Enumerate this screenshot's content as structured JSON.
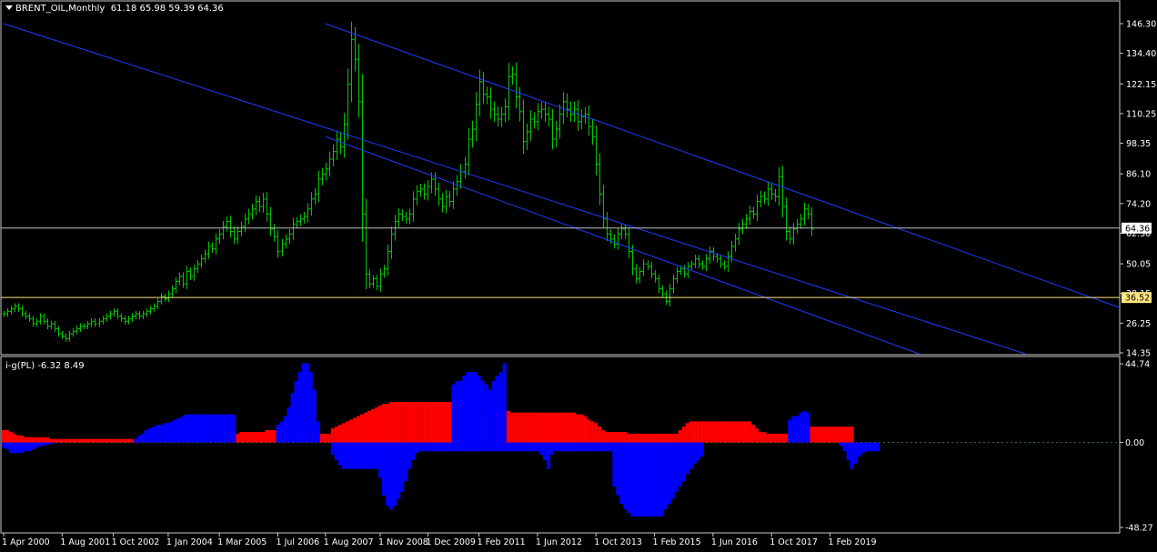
{
  "header": {
    "symbol_label": "BRENT_OIL,Monthly",
    "ohlc": "61.18 65.98 59.39 64.36",
    "dropdown_icon": "triangle-down-icon"
  },
  "indicator": {
    "label": "i-g(PL)",
    "values": "-6.32 8.49"
  },
  "chart_data": [
    {
      "type": "line",
      "subtype": "ohlc-bars",
      "title": "BRENT_OIL,Monthly",
      "ylim": [
        14.35,
        146.3
      ],
      "y_ticks": [
        "146.30",
        "134.40",
        "122.15",
        "110.25",
        "98.35",
        "86.10",
        "74.20",
        "62.30",
        "50.05",
        "38.15",
        "26.25",
        "14.35"
      ],
      "x_ticks": [
        "1 Apr 2000",
        "1 Aug 2001",
        "1 Oct 2002",
        "1 Jan 2004",
        "1 Mar 2005",
        "1 Jul 2006",
        "1 Aug 2007",
        "1 Nov 2008",
        "1 Dec 2009",
        "1 Feb 2011",
        "1 Jun 2012",
        "1 Oct 2013",
        "1 Feb 2015",
        "1 Jun 2016",
        "1 Oct 2017",
        "1 Feb 2019"
      ],
      "x_tick_index": [
        0,
        16,
        30,
        45,
        59,
        75,
        88,
        103,
        116,
        130,
        146,
        162,
        178,
        194,
        210,
        226
      ],
      "current_price": "64.36",
      "level_line": "36.52",
      "closes": [
        30,
        31,
        32,
        33,
        32,
        30,
        29,
        28,
        26,
        27,
        29,
        27,
        25,
        26,
        24,
        22,
        21,
        20,
        22,
        23,
        24,
        25,
        25,
        26,
        27,
        26,
        27,
        28,
        29,
        30,
        31,
        29,
        28,
        27,
        28,
        29,
        30,
        29,
        30,
        31,
        32,
        33,
        35,
        37,
        36,
        38,
        40,
        43,
        45,
        42,
        47,
        45,
        48,
        50,
        52,
        54,
        57,
        56,
        60,
        62,
        65,
        67,
        63,
        60,
        63,
        65,
        68,
        70,
        72,
        75,
        73,
        76,
        70,
        64,
        61,
        55,
        58,
        60,
        62,
        66,
        67,
        68,
        69,
        72,
        76,
        78,
        84,
        86,
        88,
        92,
        95,
        100,
        97,
        106,
        122,
        140,
        132,
        115,
        70,
        46,
        42,
        44,
        41,
        46,
        48,
        55,
        62,
        67,
        70,
        69,
        68,
        70,
        76,
        79,
        80,
        78,
        81,
        84,
        80,
        76,
        73,
        77,
        75,
        80,
        83,
        87,
        90,
        100,
        104,
        114,
        123,
        118,
        117,
        112,
        110,
        108,
        110,
        113,
        125,
        126,
        117,
        111,
        99,
        103,
        108,
        107,
        111,
        112,
        110,
        108,
        100,
        104,
        110,
        115,
        112,
        110,
        112,
        107,
        109,
        110,
        105,
        101,
        90,
        78,
        68,
        62,
        60,
        58,
        62,
        64,
        62,
        55,
        48,
        44,
        47,
        50,
        49,
        46,
        44,
        40,
        38,
        35,
        40,
        44,
        47,
        48,
        46,
        49,
        50,
        52,
        50,
        49,
        52,
        55,
        53,
        52,
        50,
        49,
        53,
        57,
        60,
        64,
        66,
        68,
        71,
        70,
        75,
        77,
        76,
        80,
        78,
        77,
        85,
        73,
        63,
        60,
        64,
        66,
        68,
        72,
        70,
        64
      ],
      "trendlines": [
        {
          "from": [
            "1 Apr 2000",
            146.3
          ],
          "to": [
            "1 Feb 2015",
            62.0
          ]
        },
        {
          "from": [
            "1 Aug 2007",
            146.3
          ],
          "to": [
            "1 Feb 2019",
            74.0
          ]
        },
        {
          "from": [
            "1 Aug 2007",
            101.0
          ],
          "to": [
            "1 Feb 2019",
            27.0
          ]
        }
      ]
    },
    {
      "type": "bar",
      "title": "i-g(PL) -6.32 8.49",
      "ylim": [
        -48.27,
        44.74
      ],
      "y_ticks": [
        "44.74",
        "0.00",
        "-48.27"
      ],
      "zero_label": "0.00",
      "series": [
        {
          "color": "#ff0000",
          "values": [
            7,
            7,
            6,
            5,
            4,
            4,
            3,
            3,
            3,
            3,
            3,
            3,
            3,
            2,
            2,
            2,
            2,
            2,
            2,
            2,
            2,
            2,
            2,
            2,
            2,
            2,
            2,
            2,
            2,
            2,
            2,
            2,
            2,
            2,
            2,
            2,
            2,
            2,
            2,
            2,
            2,
            2,
            2,
            2,
            2,
            2,
            2,
            2,
            3,
            3,
            4,
            4,
            4,
            4,
            4,
            4,
            4,
            4,
            4,
            4,
            5,
            5,
            5,
            5,
            5,
            6,
            6,
            6,
            6,
            6,
            6,
            6,
            7,
            7,
            7,
            7,
            7,
            7,
            6,
            6,
            6,
            6,
            6,
            6,
            6,
            5,
            5,
            5,
            5,
            5,
            8,
            9,
            10,
            11,
            12,
            13,
            14,
            15,
            16,
            17,
            18,
            19,
            20,
            21,
            22,
            22,
            23,
            23,
            23,
            23,
            23,
            23,
            23,
            23,
            23,
            23,
            23,
            23,
            23,
            23,
            23,
            23,
            23,
            23,
            23,
            22,
            20,
            18,
            18,
            18,
            18,
            18,
            18,
            18,
            18,
            18,
            18,
            18,
            18,
            17,
            17,
            17,
            17,
            17,
            17,
            17,
            17,
            17,
            17,
            17,
            17,
            17,
            17,
            17,
            17,
            17,
            17,
            16,
            16,
            15,
            13,
            12,
            11,
            9,
            7,
            6,
            6,
            6,
            6,
            6,
            6,
            5,
            5,
            5,
            5,
            5,
            5,
            5,
            5,
            5,
            5,
            5,
            5,
            5,
            5,
            7,
            9,
            11,
            12,
            12,
            12,
            12,
            12,
            12,
            12,
            12,
            12,
            12,
            12,
            12,
            12,
            12,
            12,
            12,
            12,
            10,
            8,
            6,
            6,
            5,
            5,
            5,
            5,
            5,
            5,
            5,
            5,
            7,
            8,
            9,
            9,
            9,
            9,
            9,
            9,
            9,
            9,
            9,
            9,
            9,
            9,
            9,
            9
          ]
        },
        {
          "color": "#0000ff",
          "values": [
            0,
            0,
            0,
            0,
            0,
            0,
            0,
            0,
            0,
            0,
            0,
            0,
            0,
            0,
            0,
            0,
            0,
            0,
            0,
            0,
            0,
            0,
            0,
            0,
            0,
            0,
            0,
            0,
            0,
            0,
            0,
            0,
            0,
            0,
            0,
            0,
            2,
            4,
            5,
            7,
            8,
            9,
            10,
            10,
            11,
            11,
            12,
            13,
            14,
            15,
            16,
            16,
            16,
            16,
            16,
            16,
            16,
            16,
            16,
            16,
            16,
            16,
            16,
            16,
            0,
            0,
            0,
            0,
            0,
            0,
            0,
            0,
            0,
            0,
            0,
            10,
            12,
            15,
            20,
            28,
            35,
            40,
            45,
            45,
            40,
            30,
            12,
            0,
            0,
            0,
            0,
            0,
            0,
            0,
            0,
            0,
            0,
            0,
            0,
            0,
            0,
            0,
            0,
            0,
            0,
            0,
            0,
            0,
            0,
            0,
            0,
            0,
            0,
            0,
            0,
            0,
            0,
            0,
            0,
            0,
            0,
            0,
            0,
            33,
            35,
            35,
            38,
            40,
            40,
            40,
            38,
            35,
            33,
            30,
            35,
            38,
            40,
            45,
            0,
            0,
            0,
            0,
            0,
            0,
            0,
            0,
            0,
            0,
            0,
            0,
            0,
            0,
            0,
            0,
            0,
            0,
            0,
            0,
            0,
            0,
            0,
            0,
            0,
            0,
            0,
            0,
            0,
            0,
            0,
            0,
            0,
            0,
            0,
            0,
            0,
            0,
            0,
            0,
            0,
            0,
            0,
            0,
            0,
            0,
            0,
            0,
            0,
            0,
            0,
            0,
            0,
            0,
            0,
            0,
            0,
            0,
            0,
            0,
            0,
            0,
            0,
            0,
            0,
            0,
            0,
            0,
            0,
            0,
            0,
            0,
            0,
            0,
            0,
            0,
            0,
            13,
            15,
            15,
            17,
            18,
            17,
            0,
            0,
            0,
            0,
            0,
            0,
            0,
            0,
            0,
            0,
            0,
            0,
            0,
            0,
            0,
            0,
            0,
            0,
            0,
            0,
            0
          ]
        },
        {
          "color": "#0000ff",
          "values": [
            -3,
            -4,
            -6,
            -6,
            -6,
            -6,
            -5,
            -5,
            -4,
            -3,
            -2,
            -2,
            -1,
            -1,
            0,
            0,
            0,
            0,
            0,
            0,
            0,
            0,
            0,
            0,
            0,
            0,
            0,
            0,
            0,
            0,
            0,
            0,
            0,
            0,
            0,
            0,
            0,
            0,
            0,
            0,
            0,
            0,
            0,
            0,
            0,
            0,
            0,
            0,
            0,
            0,
            0,
            0,
            0,
            0,
            0,
            0,
            0,
            0,
            0,
            0,
            0,
            0,
            0,
            0,
            0,
            0,
            0,
            0,
            0,
            0,
            0,
            0,
            0,
            0,
            0,
            0,
            0,
            0,
            0,
            0,
            0,
            0,
            0,
            0,
            0,
            0,
            0,
            0,
            0,
            0,
            -7,
            -10,
            -13,
            -15,
            -15,
            -15,
            -15,
            -15,
            -15,
            -15,
            -15,
            -15,
            -15,
            -20,
            -30,
            -36,
            -38,
            -36,
            -32,
            -28,
            -22,
            -15,
            -10,
            -6,
            -5,
            -5,
            -5,
            -5,
            -5,
            -5,
            -5,
            -5,
            -5,
            -5,
            -5,
            -5,
            -5,
            -5,
            -5,
            -5,
            -5,
            -5,
            -5,
            -5,
            -5,
            -5,
            -5,
            -5,
            -5,
            -5,
            -5,
            -5,
            -5,
            -5,
            -5,
            -5,
            -5,
            -7,
            -10,
            -15,
            -7,
            -5,
            -5,
            -5,
            -5,
            -5,
            -5,
            -5,
            -5,
            -5,
            -5,
            -5,
            -5,
            -5,
            -5,
            -5,
            -5,
            -25,
            -30,
            -35,
            -38,
            -40,
            -42,
            -42,
            -42,
            -42,
            -42,
            -42,
            -42,
            -42,
            -42,
            -38,
            -35,
            -32,
            -28,
            -25,
            -22,
            -18,
            -15,
            -12,
            -10,
            -8,
            0,
            0,
            0,
            0,
            0,
            0,
            0,
            0,
            0,
            0,
            0,
            0,
            0,
            0,
            0,
            0,
            0,
            0,
            0,
            0,
            0,
            0,
            0,
            0,
            0,
            0,
            0,
            0,
            0,
            0,
            0,
            0,
            0,
            0,
            0,
            0,
            0,
            -2,
            -5,
            -10,
            -15,
            -12,
            -8,
            -6,
            -5,
            -5,
            -5,
            -5
          ]
        }
      ]
    }
  ]
}
